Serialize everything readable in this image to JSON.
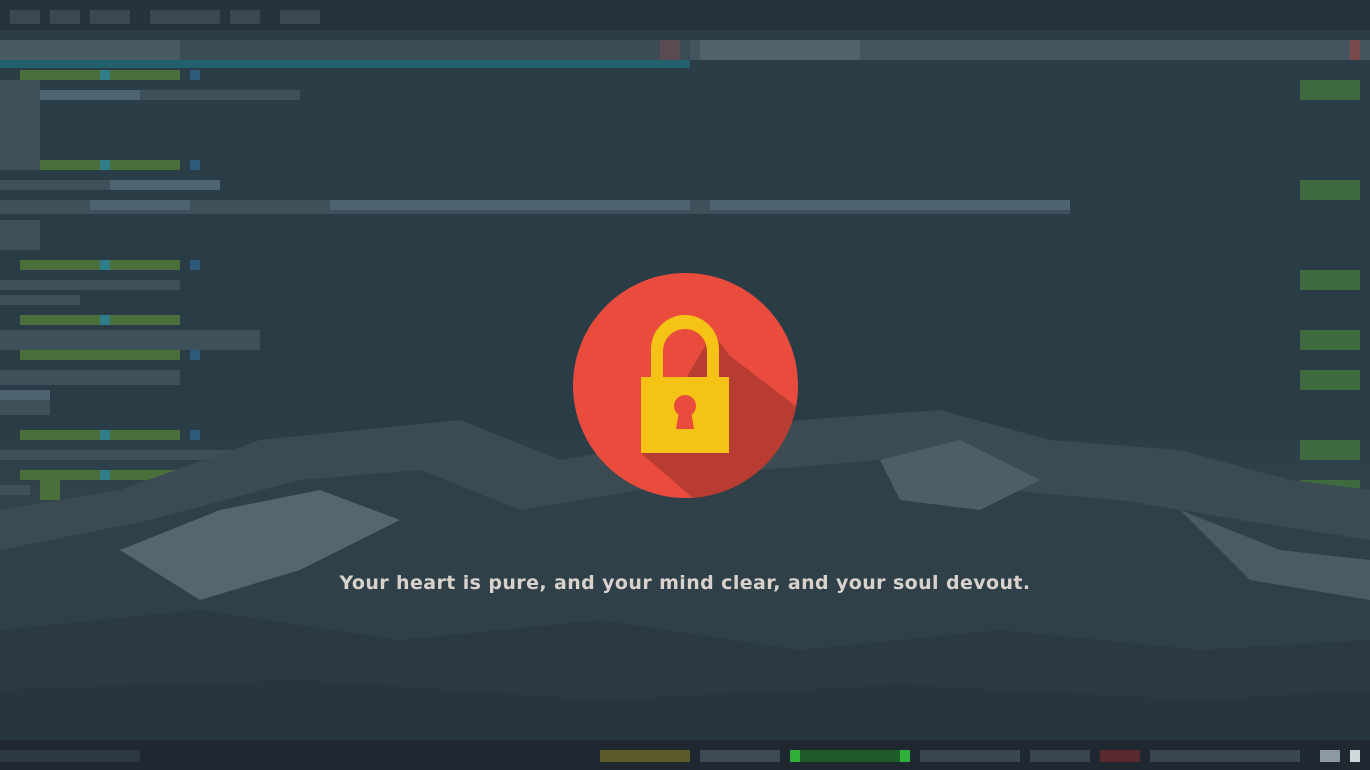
{
  "lock_screen": {
    "message": "Your heart is pure, and your mind clear, and your soul devout.",
    "icon": "padlock-icon"
  },
  "colors": {
    "badge_red": "#e94b3c",
    "padlock_yellow": "#f4c316",
    "shadow_red": "#b83c32"
  }
}
